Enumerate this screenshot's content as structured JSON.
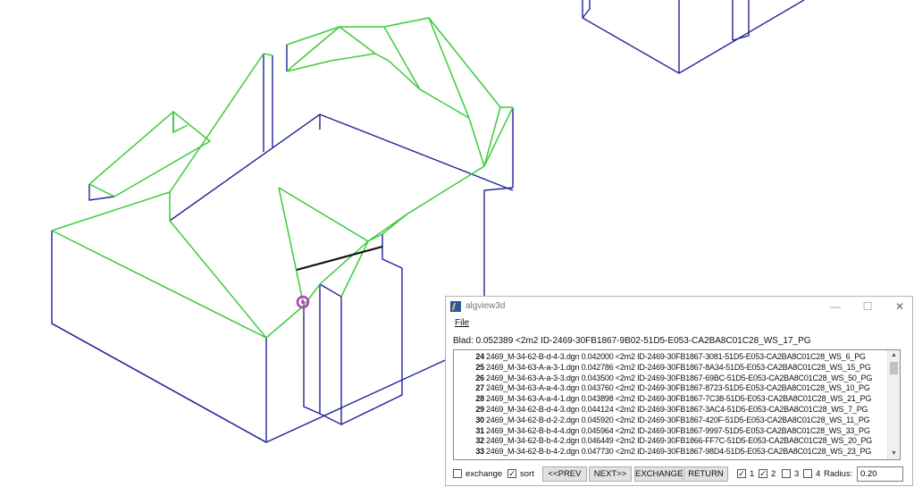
{
  "window": {
    "title": "algview3d",
    "minimize": "—",
    "maximize": "☐",
    "close": "✕"
  },
  "menu": {
    "file": "File"
  },
  "blad": "Blad:  0.052389 <2m2 ID-2469-30FB1867-9B02-51D5-E053-CA2BA8C01C28_WS_17_PG",
  "list": [
    {
      "num": "24",
      "text": "2469_M-34-62-B-d-4-3.dgn 0.042000 <2m2 ID-2469-30FB1867-3081-51D5-E053-CA2BA8C01C28_WS_6_PG"
    },
    {
      "num": "25",
      "text": "2469_M-34-63-A-a-3-1.dgn 0.042786 <2m2 ID-2469-30FB1867-8A34-51D5-E053-CA2BA8C01C28_WS_15_PG"
    },
    {
      "num": "26",
      "text": "2469_M-34-63-A-a-3-3.dgn 0.043500 <2m2 ID-2469-30FB1867-69BC-51D5-E053-CA2BA8C01C28_WS_50_PG"
    },
    {
      "num": "27",
      "text": "2469_M-34-63-A-a-4-3.dgn 0.043760 <2m2 ID-2469-30FB1867-8723-51D5-E053-CA2BA8C01C28_WS_10_PG"
    },
    {
      "num": "28",
      "text": "2469_M-34-63-A-a-4-1.dgn 0.043898 <2m2 ID-2469-30FB1867-7C38-51D5-E053-CA2BA8C01C28_WS_21_PG"
    },
    {
      "num": "29",
      "text": "2469_M-34-62-B-d-4-3.dgn 0.044124 <2m2 ID-2469-30FB1867-3AC4-51D5-E053-CA2BA8C01C28_WS_7_PG"
    },
    {
      "num": "30",
      "text": "2469_M-34-62-B-d-2-2.dgn 0.045920 <2m2 ID-2469-30FB1867-420F-51D5-E053-CA2BA8C01C28_WS_11_PG"
    },
    {
      "num": "31",
      "text": "2469_M-34-62-B-b-4-4.dgn 0.045964 <2m2 ID-2469-30FB1867-9997-51D5-E053-CA2BA8C01C28_WS_33_PG"
    },
    {
      "num": "32",
      "text": "2469_M-34-62-B-b-4-2.dgn 0.046449 <2m2 ID-2469-30FB1866-FF7C-51D5-E053-CA2BA8C01C28_WS_20_PG"
    },
    {
      "num": "33",
      "text": "2469_M-34-62-B-b-4-2.dgn 0.047730 <2m2 ID-2469-30FB1867-98D4-51D5-E053-CA2BA8C01C28_WS_23_PG"
    }
  ],
  "scroll": {
    "up": "▲",
    "down": "▼"
  },
  "controls": {
    "exchange_chk": "",
    "exchange_label": "exchange",
    "sort_chk": "✓",
    "sort_label": "sort",
    "prev": "<<PREV",
    "next": "NEXT>>",
    "exchange_btn": "EXCHANGE",
    "return_btn": "RETURN",
    "c1_chk": "✓",
    "c1_label": "1",
    "c2_chk": "✓",
    "c2_label": "2",
    "c3_chk": "",
    "c3_label": "3",
    "c4_chk": "",
    "c4_label": "4",
    "radius_label": "Radius:",
    "radius_value": "0.20"
  },
  "colors": {
    "edge_blue": "#22229a",
    "roof_green": "#3ccc3c",
    "marker": "#b83cb8"
  }
}
